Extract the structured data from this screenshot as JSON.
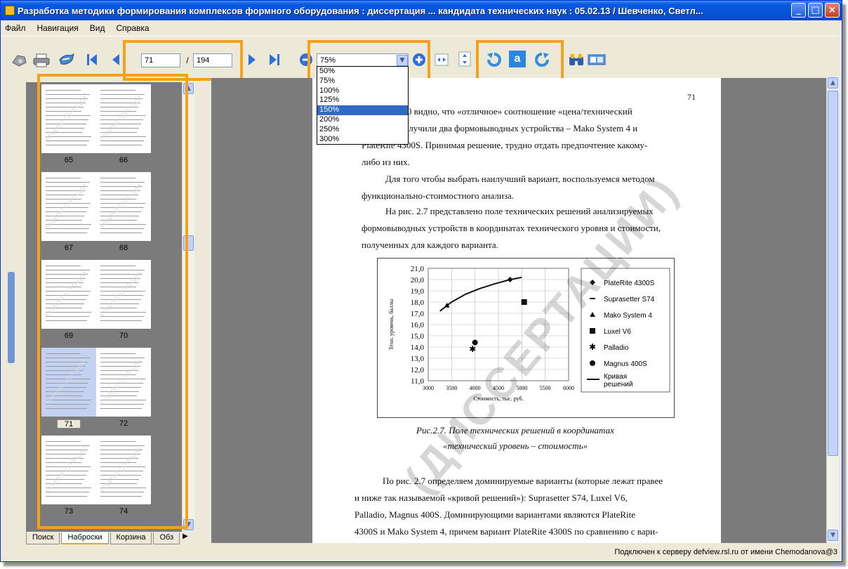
{
  "window": {
    "title": "Разработка методики формирования комплексов формного оборудования : диссертация ... кандидата технических наук : 05.02.13 / Шевченко, Светл...",
    "controls": [
      "_",
      "□",
      "×"
    ]
  },
  "menu": [
    "Файл",
    "Навигация",
    "Вид",
    "Справка"
  ],
  "toolbar": {
    "current_page": "71",
    "separator": "/",
    "total_pages": "194",
    "zoom_value": "75%",
    "zoom_options": [
      "50%",
      "75%",
      "100%",
      "125%",
      "150%",
      "200%",
      "250%",
      "300%"
    ],
    "zoom_highlighted": "150%",
    "icons": [
      "view-icon",
      "print-icon",
      "save-icon",
      "first-page-icon",
      "prev-page-icon",
      "next-page-icon",
      "last-page-icon",
      "zoom-out-icon",
      "zoom-in-icon",
      "fit-width-icon",
      "fit-height-icon",
      "rotate-left-icon",
      "text-mode-icon",
      "rotate-right-icon",
      "binoculars-icon",
      "compare-icon"
    ],
    "highlight_color": "#f7a11a"
  },
  "thumbnails": {
    "pages": [
      "65",
      "66",
      "67",
      "68",
      "69",
      "70",
      "71",
      "72",
      "73",
      "74"
    ],
    "current": "71",
    "watermark": "РЕФЕРАТ-СЕРТАЦИИ"
  },
  "tabs": [
    "Поиск",
    "Наброски",
    "Корзина",
    "Обз"
  ],
  "active_tab": "Наброски",
  "document": {
    "page_number": "71",
    "paragraph1": [
      "Из табл. 2.10 видно, что «отличное» соотношение «цена/технический",
      "уровень» получили два формовыводных устройства – Mako System 4 и",
      "PlateRite 4300S. Принимая решение, трудно отдать предпочтение какому-",
      "либо из них."
    ],
    "paragraph2": [
      "Для того чтобы выбрать наилучший вариант, воспользуемся методом",
      "функционально-стоимостного анализа."
    ],
    "paragraph3": [
      "На рис. 2.7 представлено поле технических решений анализируемых",
      "формовыводных устройств в координатах технического уровня и стоимости,",
      "полученных для каждого варианта."
    ],
    "caption_line1": "Рис.2.7. Поле технических решений в координатах",
    "caption_line2": "«технический уровень – стоимость»",
    "paragraph4": [
      "По рис. 2.7 определяем доминируемые варианты (которые лежат правее",
      "и ниже так называемой «кривой решений»): Suprasetter S74, Luxel V6,",
      "Palladio, Magnus 400S. Доминирующими вариантами являются PlateRite",
      "4300S и Mako System 4, причем вариант PlateRite 4300S по сравнению с вари-"
    ],
    "watermark": "(ДИССЕРТАЦИИ)"
  },
  "chart_data": {
    "type": "scatter",
    "xlabel": "Стоимость, тыс. руб.",
    "ylabel": "Техн. уровень, баллы",
    "xlim": [
      3000,
      6000
    ],
    "ylim": [
      11.0,
      21.0
    ],
    "x_ticks": [
      "3000",
      "3500",
      "4000",
      "4500",
      "5000",
      "5500",
      "6000"
    ],
    "y_ticks": [
      "11,0",
      "12,0",
      "13,0",
      "14,0",
      "15,0",
      "16,0",
      "17,0",
      "18,0",
      "19,0",
      "20,0",
      "21,0"
    ],
    "grid": true,
    "legend_position": "right",
    "series": [
      {
        "name": "PlateRite 4300S",
        "marker": "diamond",
        "points": [
          [
            4750,
            20.0
          ]
        ]
      },
      {
        "name": "Suprasetter S74",
        "marker": "dash",
        "points": []
      },
      {
        "name": "Mako System 4",
        "marker": "triangle",
        "points": [
          [
            3400,
            17.7
          ]
        ]
      },
      {
        "name": "Luxel V6",
        "marker": "square",
        "points": [
          [
            5050,
            18.0
          ]
        ]
      },
      {
        "name": "Palladio",
        "marker": "star",
        "points": [
          [
            3950,
            13.8
          ]
        ]
      },
      {
        "name": "Magnus 400S",
        "marker": "circle",
        "points": [
          [
            4000,
            14.4
          ]
        ]
      },
      {
        "name": "Кривая решений",
        "marker": "line",
        "points": [
          [
            3250,
            17.2
          ],
          [
            3500,
            18.0
          ],
          [
            3800,
            18.7
          ],
          [
            4100,
            19.2
          ],
          [
            4400,
            19.6
          ],
          [
            4750,
            20.0
          ],
          [
            5000,
            20.2
          ]
        ]
      }
    ]
  },
  "status": {
    "text": "Подключен к серверу defview.rsl.ru от имени Chemodanova@3"
  }
}
